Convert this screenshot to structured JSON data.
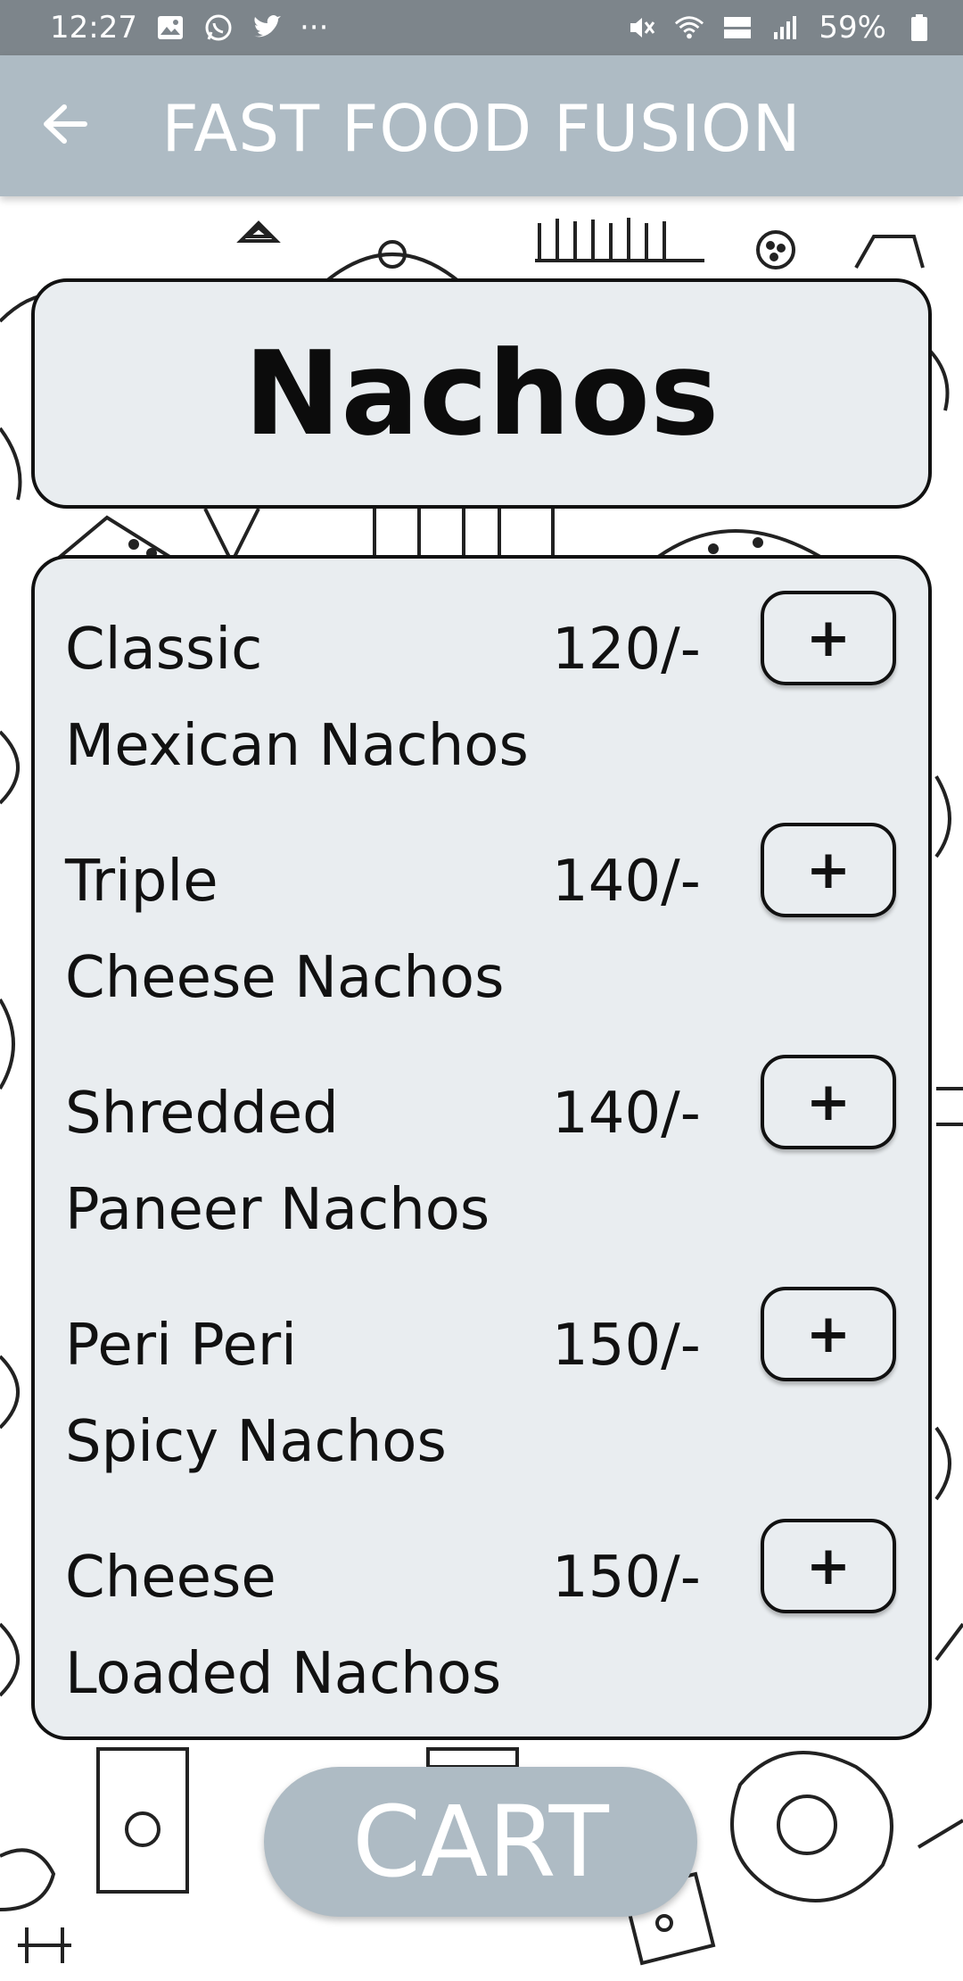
{
  "status_bar": {
    "time": "12:27",
    "battery_text": "59%",
    "more_indicator": "···",
    "left_icons": [
      "gallery-icon",
      "whatsapp-icon",
      "twitter-icon"
    ],
    "right_icons": [
      "mute-icon",
      "wifi-icon",
      "volte-icon",
      "signal-icon",
      "battery-icon"
    ]
  },
  "app_bar": {
    "title": "FAST FOOD FUSION",
    "back_icon": "back-arrow-icon"
  },
  "category": {
    "title": "Nachos"
  },
  "menu": {
    "items": [
      {
        "name_line1": "Classic",
        "name_line2": "Mexican Nachos",
        "price": "120/-",
        "add_label": "+"
      },
      {
        "name_line1": "Triple",
        "name_line2": "Cheese Nachos",
        "price": "140/-",
        "add_label": "+"
      },
      {
        "name_line1": "Shredded",
        "name_line2": "Paneer Nachos",
        "price": "140/-",
        "add_label": "+"
      },
      {
        "name_line1": "Peri Peri",
        "name_line2": "Spicy Nachos",
        "price": "150/-",
        "add_label": "+"
      },
      {
        "name_line1": "Cheese",
        "name_line2": "Loaded Nachos",
        "price": "150/-",
        "add_label": "+"
      }
    ]
  },
  "cart": {
    "label": "CART"
  },
  "colors": {
    "app_bar": "#aebbc4",
    "status_bar": "#7d858b",
    "card_bg": "#e9edf0",
    "border": "#111111"
  }
}
